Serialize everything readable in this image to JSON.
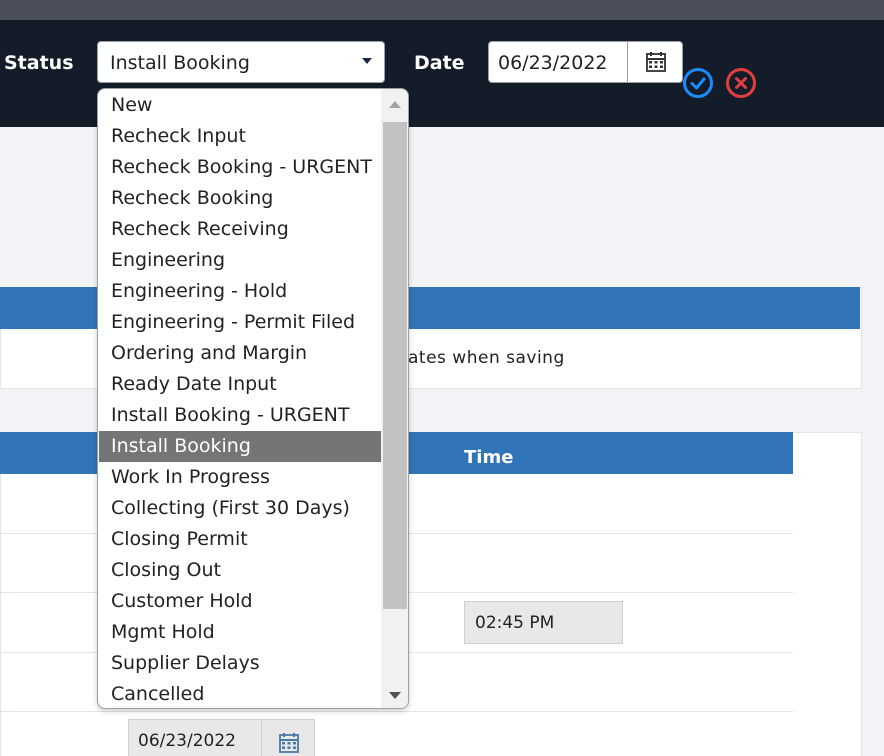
{
  "header": {
    "status_label": "Status",
    "status_value": "Install Booking",
    "date_label": "Date",
    "date_value": "06/23/2022"
  },
  "dropdown": {
    "options": [
      "New",
      "Recheck Input",
      "Recheck Booking - URGENT",
      "Recheck Booking",
      "Recheck Receiving",
      "Engineering",
      "Engineering - Hold",
      "Engineering - Permit Filed",
      "Ordering and Margin",
      "Ready Date Input",
      "Install Booking - URGENT",
      "Install Booking",
      "Work In Progress",
      "Collecting (First 30 Days)",
      "Closing Permit",
      "Closing Out",
      "Customer Hold",
      "Mgmt Hold",
      "Supplier Delays",
      "Cancelled"
    ],
    "selected": "Install Booking"
  },
  "panel1": {
    "note_fragment": "ates when saving"
  },
  "table": {
    "time_header": "Time",
    "time_value": "02:45 PM",
    "date_value": "06/23/2022"
  },
  "colors": {
    "header_bg": "#141c2a",
    "accent_blue": "#3274b8",
    "confirm": "#1a8cff",
    "cancel": "#e53e3e",
    "selected_option_bg": "#757575"
  }
}
